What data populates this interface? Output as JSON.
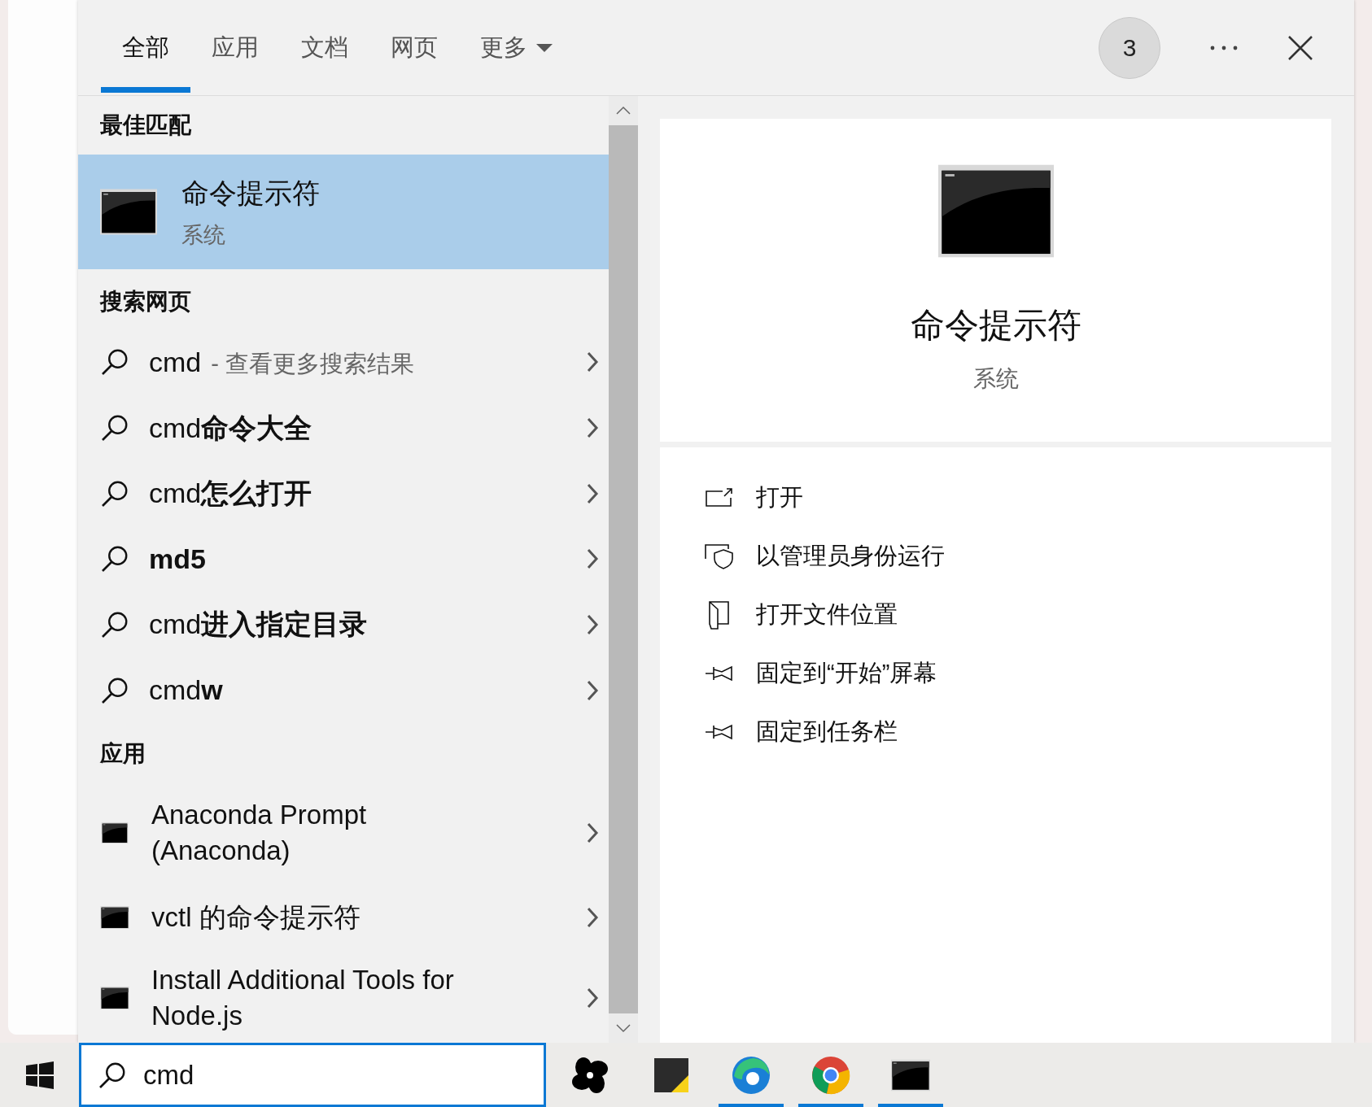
{
  "tabs": [
    {
      "label": "全部",
      "selected": true
    },
    {
      "label": "应用",
      "selected": false
    },
    {
      "label": "文档",
      "selected": false
    },
    {
      "label": "网页",
      "selected": false
    },
    {
      "label": "更多",
      "selected": false,
      "dropdown": true
    }
  ],
  "badge": "3",
  "best_match": {
    "heading": "最佳匹配",
    "item": {
      "title": "命令提示符",
      "subtitle": "系统",
      "selected": true
    }
  },
  "web_search": {
    "heading": "搜索网页",
    "items": [
      {
        "text": "cmd",
        "note": "- 查看更多搜索结果"
      },
      {
        "text": "cmd**命令大全**"
      },
      {
        "text": "cmd**怎么打开**"
      },
      {
        "text": "**md5**"
      },
      {
        "text": "cmd**进入指定目录**"
      },
      {
        "text": "cmd**w**"
      }
    ]
  },
  "apps": {
    "heading": "应用",
    "items": [
      {
        "name": "Anaconda Prompt (Anaconda)",
        "kind": "prompt"
      },
      {
        "name": "vctl 的命令提示符",
        "kind": "console"
      },
      {
        "name": "Install Additional Tools for Node.js",
        "kind": "console"
      }
    ]
  },
  "preview": {
    "title": "命令提示符",
    "subtitle": "系统",
    "actions": [
      {
        "label": "打开",
        "kind": "open"
      },
      {
        "label": "以管理员身份运行",
        "kind": "shield"
      },
      {
        "label": "打开文件位置",
        "kind": "folder"
      },
      {
        "label": "固定到“开始”屏幕",
        "kind": "pin"
      },
      {
        "label": "固定到任务栏",
        "kind": "pin"
      }
    ]
  },
  "taskbar": {
    "search_value": "cmd",
    "apps": [
      {
        "kind": "pinwheel",
        "running": false
      },
      {
        "kind": "notes",
        "running": false
      },
      {
        "kind": "edge",
        "running": true
      },
      {
        "kind": "chrome",
        "running": true
      },
      {
        "kind": "terminal",
        "running": true
      }
    ]
  }
}
